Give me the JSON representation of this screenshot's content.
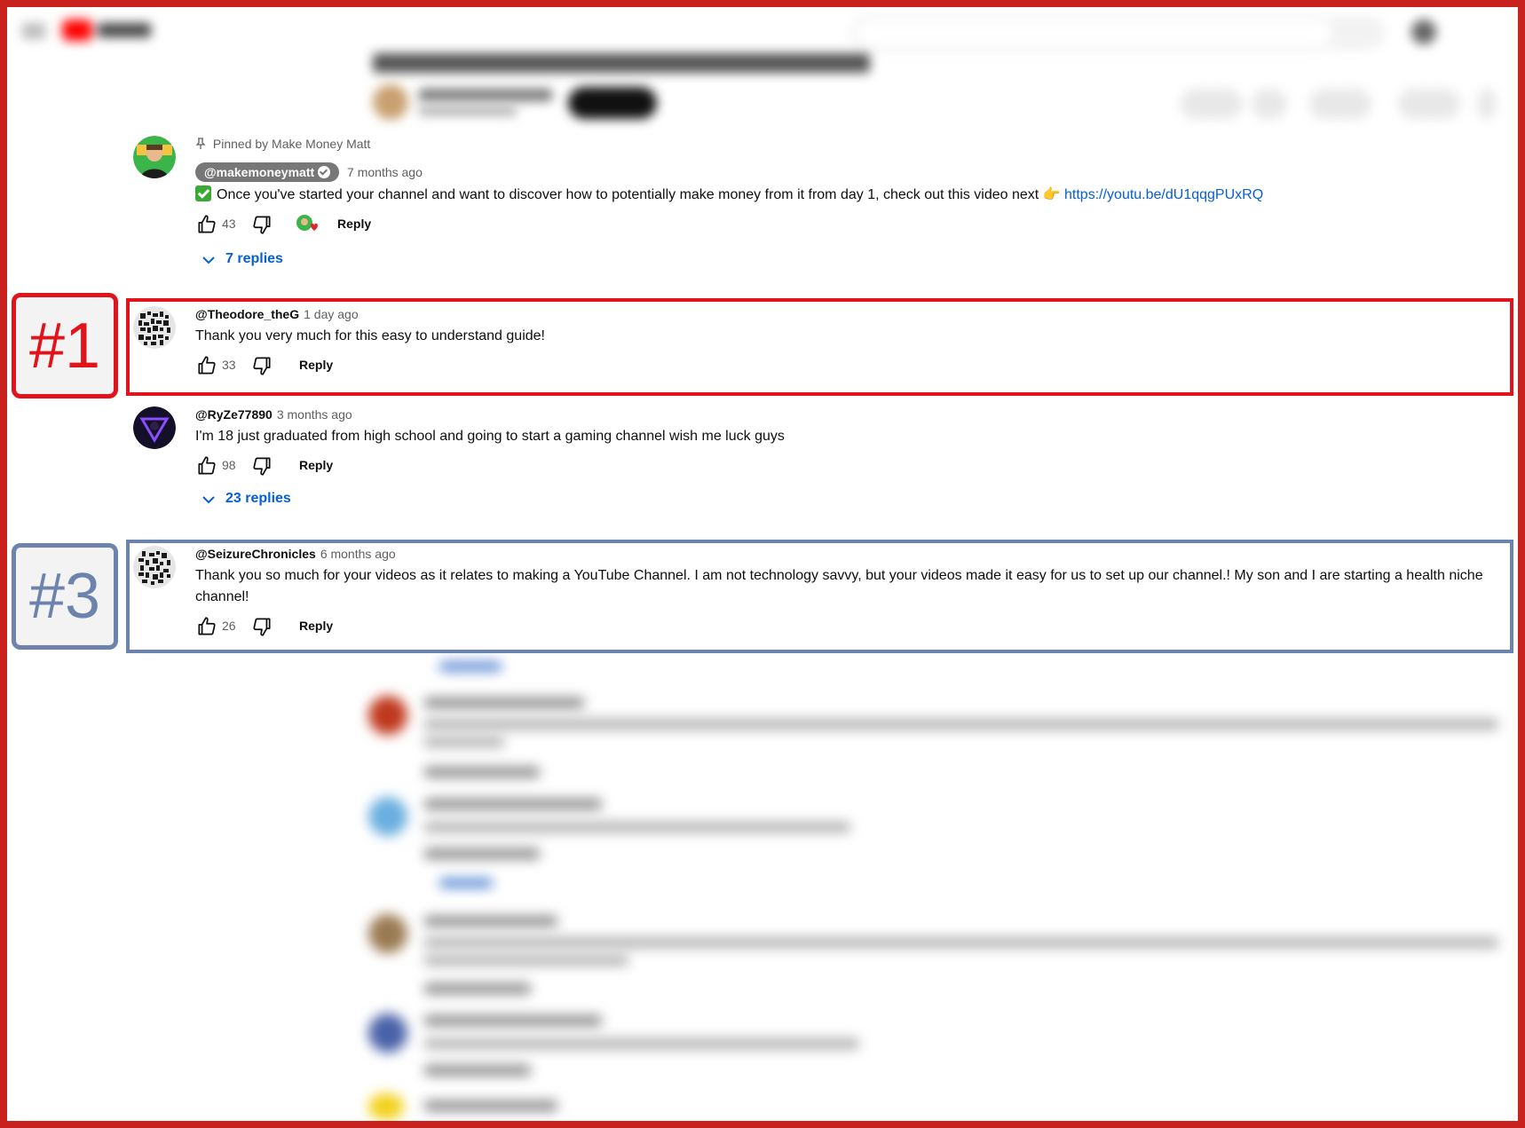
{
  "pinned_comment": {
    "pinned_label": "Pinned by Make Money Matt",
    "author": "@makemoneymatt",
    "time": "7 months ago",
    "text_before_link": "Once you've started your channel and want to discover how to potentially make money from it from day 1, check out this video next 👉 ",
    "link": "https://youtu.be/dU1qqgPUxRQ",
    "likes": "43",
    "reply_label": "Reply",
    "replies_label": "7 replies"
  },
  "comments": [
    {
      "author": "@Theodore_theG",
      "time": "1 day ago",
      "text": "Thank you very much for this easy to understand guide!",
      "likes": "33",
      "reply_label": "Reply"
    },
    {
      "author": "@RyZe77890",
      "time": "3 months ago",
      "text": "I'm 18 just graduated from high school and going to start a gaming channel wish me luck guys",
      "likes": "98",
      "reply_label": "Reply",
      "replies_label": "23 replies"
    },
    {
      "author": "@SeizureChronicles",
      "time": "6 months ago",
      "text": "Thank you so much for your videos as it relates to making a YouTube Channel. I am not technology savvy, but your videos made it easy for us to set up our channel.! My son and I are starting a health niche channel!",
      "likes": "26",
      "reply_label": "Reply"
    }
  ],
  "annotations": {
    "tag_1": "#1",
    "tag_3": "#3"
  },
  "colors": {
    "frame": "#c9211e",
    "highlight_red": "#e0141a",
    "highlight_blue": "#6c84ad",
    "link": "#065fd4"
  }
}
